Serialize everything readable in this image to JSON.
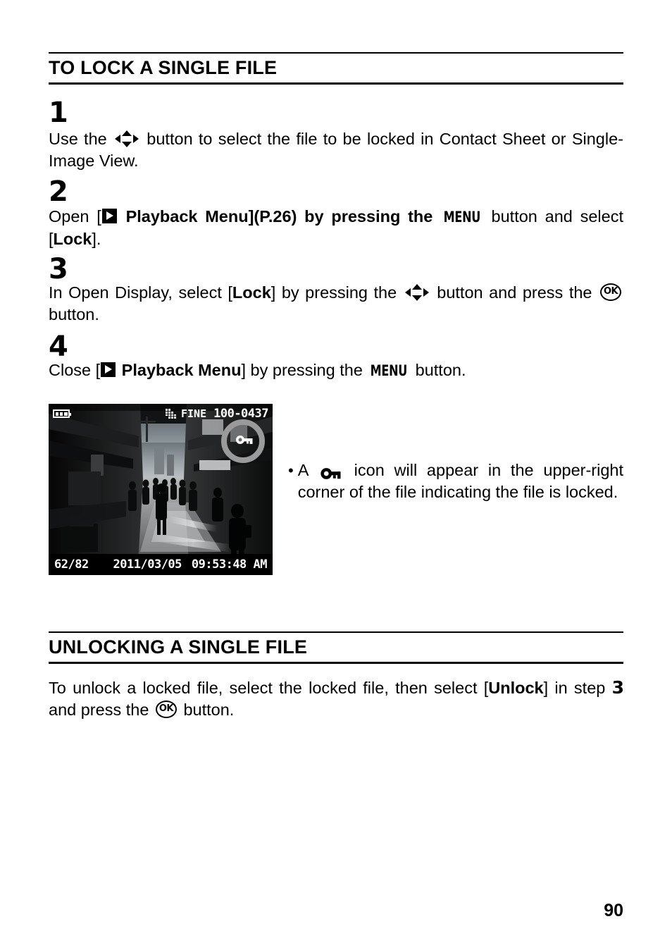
{
  "document": {
    "page_number": "90"
  },
  "section_lock": {
    "heading": "TO LOCK A SINGLE FILE",
    "steps": [
      {
        "number": "1",
        "text_before_icon": "Use the",
        "icon": "dpad-icon",
        "text_after_icon": "button to select the file to be locked in Contact Sheet or Single-Image View."
      },
      {
        "number": "2",
        "part_1": "Open [",
        "icon_playback": "playback-icon",
        "part_2_bold": "Playback Menu",
        "part_3": "](",
        "page_ref": "P.26",
        "part_4": ") by pressing the",
        "icon_menu": "MENU",
        "part_5": "button and select [",
        "part_6_bold": "Lock",
        "part_7": "]."
      },
      {
        "number": "3",
        "part_1": "In Open Display, select [",
        "part_2_bold": "Lock",
        "part_3": "] by pressing the",
        "icon_dpad": "dpad-icon",
        "part_4": "button and press the",
        "icon_ok": "OK",
        "part_5": "button."
      },
      {
        "number": "4",
        "part_1": "Close [",
        "icon_playback": "playback-icon",
        "part_2_bold": "Playback Menu",
        "part_3": "] by pressing the",
        "icon_menu": "MENU",
        "part_4": "button."
      }
    ],
    "note": {
      "bullet": "•",
      "part_1": "A",
      "icon_key": "key-icon",
      "part_2": "icon will appear in the upper-right corner of the file indicating the file is locked."
    }
  },
  "camera_lcd": {
    "battery_icon": "battery-full-icon",
    "quality_icon": "image-quality-grid-icon",
    "quality_label": "FINE",
    "file_number": "100-0437",
    "frame_counter": "62/82",
    "date": "2011/03/05",
    "time": "09:53:48 AM",
    "lock_indicator_icon": "key-lock-icon",
    "highlight_ring": "highlight-circle",
    "photo_description": "Black and white photo of a narrow shopping street with people walking"
  },
  "section_unlock": {
    "heading": "UNLOCKING A SINGLE FILE",
    "paragraph": {
      "part_1": "To unlock a locked file, select the locked file, then select [",
      "part_2_bold": "Unlock",
      "part_3": "] in step",
      "step_ref": "3",
      "part_4": "and press the",
      "icon_ok": "OK",
      "part_5": "button."
    }
  },
  "colors": {
    "text": "#000000",
    "background": "#ffffff",
    "highlight_ring": "#9a9a9a",
    "lcd_background": "#0a0a0a"
  }
}
